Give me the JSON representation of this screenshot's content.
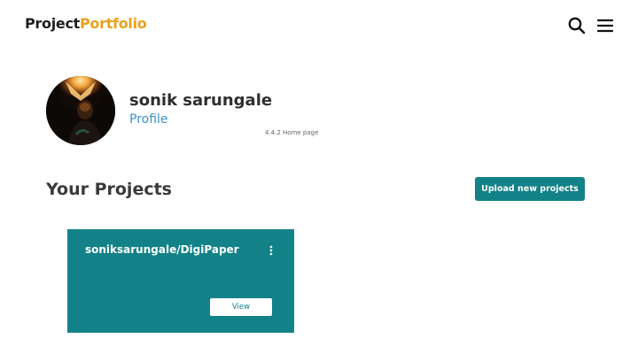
{
  "header": {
    "logo_part1": "Project",
    "logo_part2": "Portfolio",
    "search_icon": "search-icon",
    "menu_icon": "hamburger-menu-icon"
  },
  "profile": {
    "name": "sonik sarungale",
    "link_label": "Profile",
    "version_note": "4.4.2 Home page",
    "avatar": "profile-photo"
  },
  "projects": {
    "heading": "Your Projects",
    "upload_label": "Upload new projects",
    "items": [
      {
        "title": "soniksarungale/DigiPaper",
        "view_label": "View",
        "menu_icon": "more-vertical-icon"
      }
    ]
  },
  "colors": {
    "accent": "#138288",
    "logo_accent": "#e8a21e",
    "link": "#3a93c9"
  }
}
